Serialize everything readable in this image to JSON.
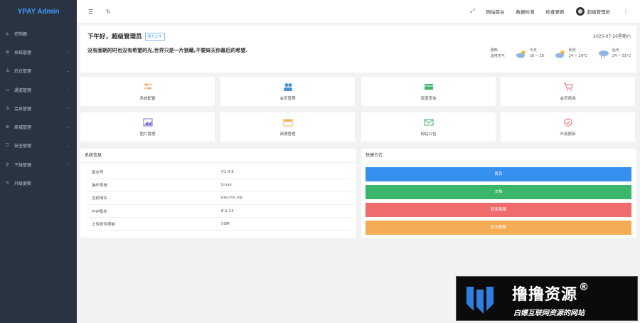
{
  "brand": "YPAY Admin",
  "sidebar": {
    "items": [
      {
        "label": "控制器",
        "icon": "home-icon",
        "arrow": false
      },
      {
        "label": "系统管理",
        "icon": "gear-icon",
        "arrow": true
      },
      {
        "label": "后台管理",
        "icon": "user-icon",
        "arrow": true
      },
      {
        "label": "通道管理",
        "icon": "card-icon",
        "arrow": true
      },
      {
        "label": "会员管理",
        "icon": "user-icon",
        "arrow": true
      },
      {
        "label": "商城管理",
        "icon": "shop-icon",
        "arrow": true
      },
      {
        "label": "安全管理",
        "icon": "shield-icon",
        "arrow": true
      },
      {
        "label": "下级管理",
        "icon": "sitemap-icon",
        "arrow": true
      },
      {
        "label": "升级更新",
        "icon": "refresh-icon",
        "arrow": false
      }
    ]
  },
  "topbar": {
    "links": [
      "网站前台",
      "数据检测",
      "检查更新"
    ],
    "username": "超级管理员"
  },
  "greeting": {
    "title": "下午好，超级管理员",
    "badge": "努力工作",
    "date": "2025-07-26星期六",
    "quote": "没有面朝的时也没有希望的光,世界只是一片狼藉,不要妹天你最后的希望.",
    "weather": [
      {
        "line1": "肥西",
        "line2": "适用天气",
        "icon": "none"
      },
      {
        "line1": "今天",
        "line2": "26 ~ 28",
        "icon": "cloud-sun"
      },
      {
        "line1": "明天",
        "line2": "24 ~ 29°C",
        "icon": "cloud-sun"
      },
      {
        "line1": "后天",
        "line2": "24 ~ 31°C",
        "icon": "cloud-rain"
      }
    ]
  },
  "tiles": [
    {
      "label": "系统配置",
      "icon": "sliders-icon",
      "color": "#f0a35a"
    },
    {
      "label": "会员管理",
      "icon": "users-icon",
      "color": "#4a8fd9"
    },
    {
      "label": "资源查询",
      "icon": "card-icon",
      "color": "#3bb56a"
    },
    {
      "label": "会员商城",
      "icon": "cart-icon",
      "color": "#e86a6a"
    },
    {
      "label": "图片管理",
      "icon": "image-icon",
      "color": "#7a6fd8"
    },
    {
      "label": "商铺管理",
      "icon": "calendar-icon",
      "color": "#f0b35a"
    },
    {
      "label": "网站公告",
      "icon": "mail-icon",
      "color": "#3bb56a"
    },
    {
      "label": "升级更新",
      "icon": "shield-icon",
      "color": "#e86a6a"
    }
  ],
  "system_info": {
    "title": "系统信息",
    "rows": [
      {
        "key": "版本号",
        "value": "V1.4.6"
      },
      {
        "key": "操作系统",
        "value": "Linux"
      },
      {
        "key": "当前域名",
        "value": "pay.rnn.vip"
      },
      {
        "key": "PHP版本",
        "value": "8.1.13"
      },
      {
        "key": "上传附件限制",
        "value": "50M"
      }
    ]
  },
  "quick": {
    "title": "快捷方式",
    "buttons": [
      {
        "label": "首页",
        "color": "#3590f0"
      },
      {
        "label": "文档",
        "color": "#3bb56a"
      },
      {
        "label": "联系客服",
        "color": "#f06b6b"
      },
      {
        "label": "官方群聊",
        "color": "#f5ad55"
      }
    ]
  },
  "watermark": {
    "title": "撸撸资源",
    "mark": "®",
    "subtitle": "白嫖互联网资源的网站"
  }
}
